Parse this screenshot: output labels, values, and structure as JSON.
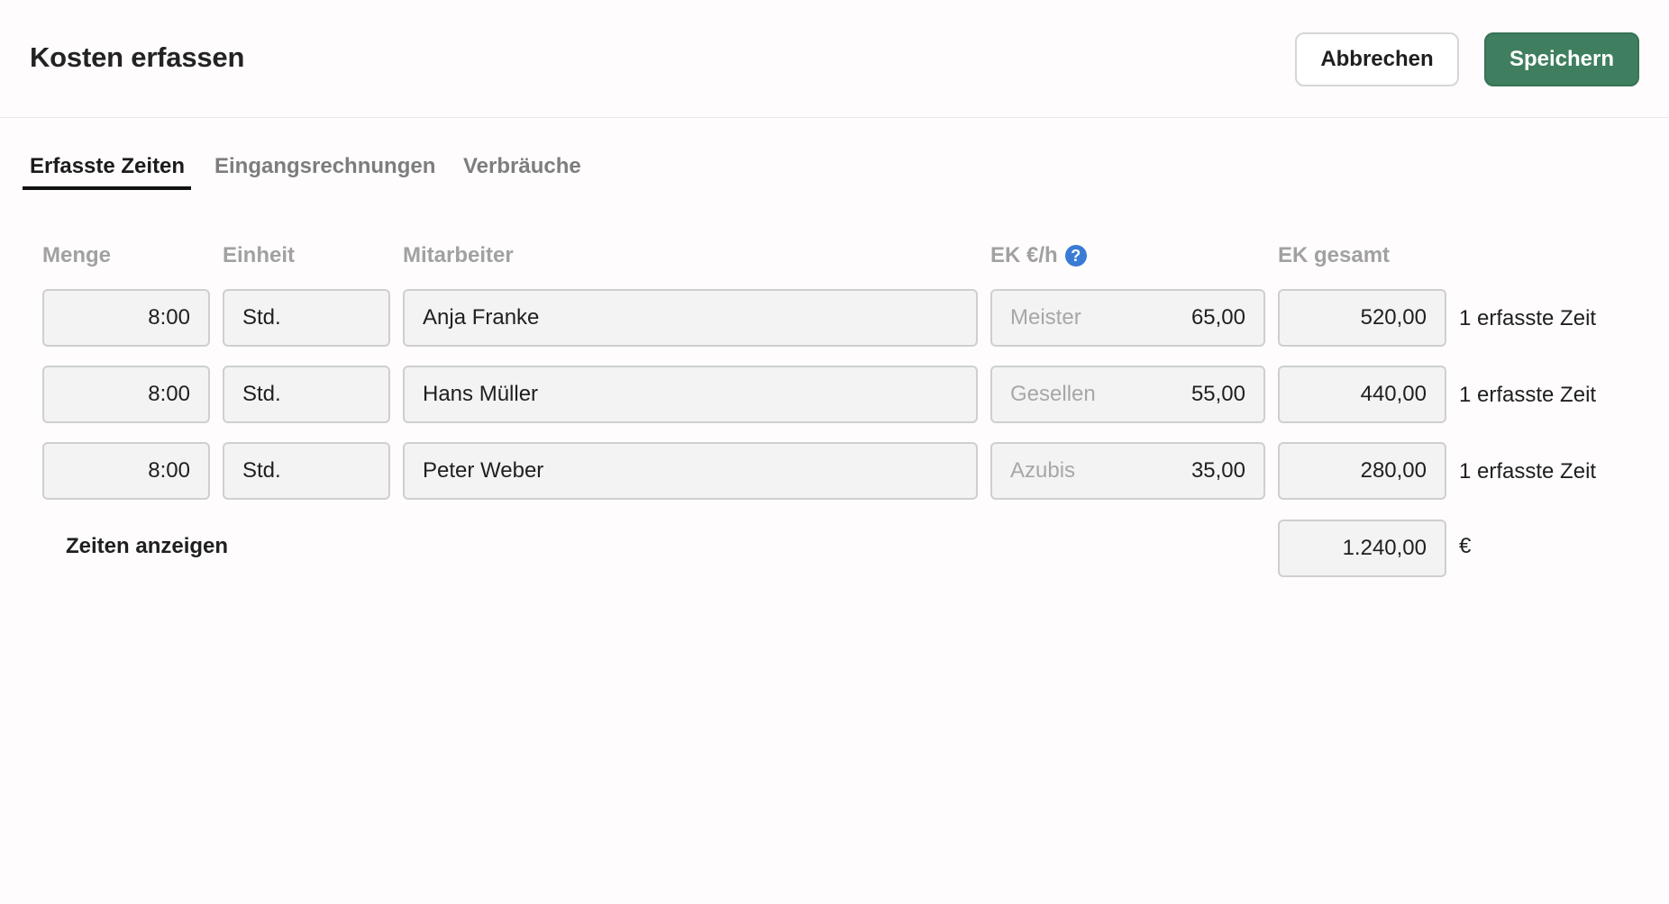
{
  "header": {
    "title": "Kosten erfassen",
    "cancel_label": "Abbrechen",
    "save_label": "Speichern"
  },
  "tabs": [
    {
      "label": "Erfasste Zeiten",
      "active": true
    },
    {
      "label": "Eingangsrechnungen",
      "active": false
    },
    {
      "label": "Verbräuche",
      "active": false
    }
  ],
  "columns": {
    "menge": "Menge",
    "einheit": "Einheit",
    "mitarbeiter": "Mitarbeiter",
    "ek_rate": "EK €/h",
    "ek_total": "EK gesamt"
  },
  "rows": [
    {
      "menge": "8:00",
      "einheit": "Std.",
      "mitarbeiter": "Anja Franke",
      "rate_group": "Meister",
      "rate": "65,00",
      "total": "520,00",
      "note": "1 erfasste Zeit"
    },
    {
      "menge": "8:00",
      "einheit": "Std.",
      "mitarbeiter": "Hans Müller",
      "rate_group": "Gesellen",
      "rate": "55,00",
      "total": "440,00",
      "note": "1 erfasste Zeit"
    },
    {
      "menge": "8:00",
      "einheit": "Std.",
      "mitarbeiter": "Peter Weber",
      "rate_group": "Azubis",
      "rate": "35,00",
      "total": "280,00",
      "note": "1 erfasste Zeit"
    }
  ],
  "footer": {
    "show_times_label": "Zeiten anzeigen",
    "sum": "1.240,00",
    "currency": "€"
  },
  "icons": {
    "help": "question-circle-icon"
  },
  "colors": {
    "primary": "#3f7f5f",
    "help_icon": "#3a7bd5"
  }
}
